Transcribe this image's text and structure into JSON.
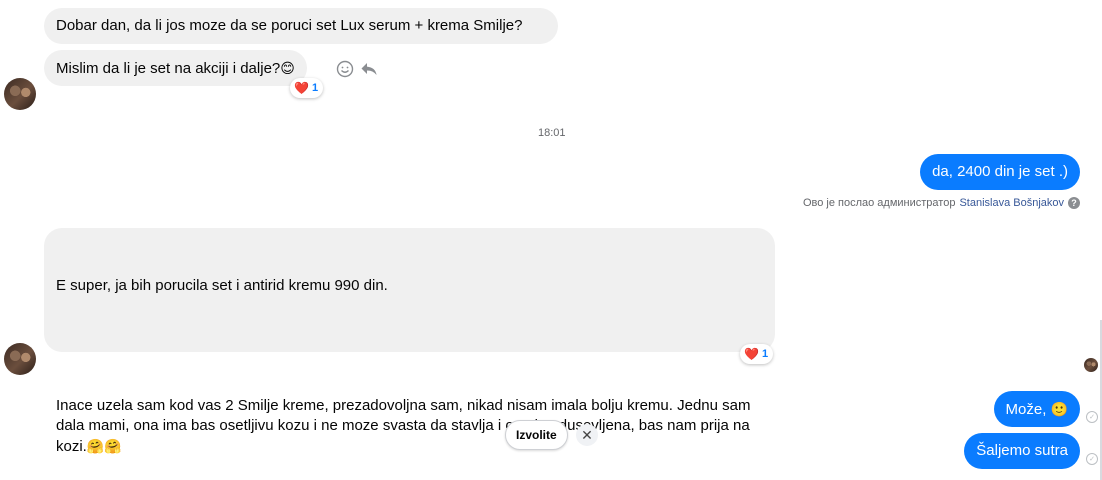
{
  "messages": {
    "m1": "Dobar dan, da li jos moze da se poruci set Lux serum + krema Smilje?",
    "m2": "Mislim da li je set na akciji i dalje?",
    "m2_emoji": "😊",
    "m2_reaction_emoji": "❤️",
    "m2_reaction_count": "1",
    "time1": "18:01",
    "m3": "da, 2400 din je set .)",
    "admin_prefix": "Ово је послао администратор",
    "admin_name": "Stanislava Bošnjakov",
    "m4_line1": "E super, ja bih porucila set i antirid kremu 990 din.",
    "m4_para2": "Inace uzela sam kod vas 2 Smilje kreme, prezadovoljna sam, nikad nisam imala bolju kremu. Jednu sam dala mami, ona ima bas osetljivu kozu i ne moze svasta da stavlja i ona je odusevljena, bas nam prija na kozi.",
    "m4_emojis": "🤗🤗",
    "m4_reaction_emoji": "❤️",
    "m4_reaction_count": "1",
    "m5": "Može,",
    "m5_emoji": "🙂",
    "m6": "Šaljemo sutra",
    "quick_reply": "Izvolite",
    "close_glyph": "✕"
  },
  "icons": {
    "smile": "emoji-react-icon",
    "reply": "reply-arrow-icon",
    "help": "help-circle-icon",
    "seen": "check-circle-icon"
  },
  "colors": {
    "outgoing_bubble": "#0a7cff",
    "incoming_bubble": "#f0f0f0",
    "admin_name": "#385898"
  }
}
